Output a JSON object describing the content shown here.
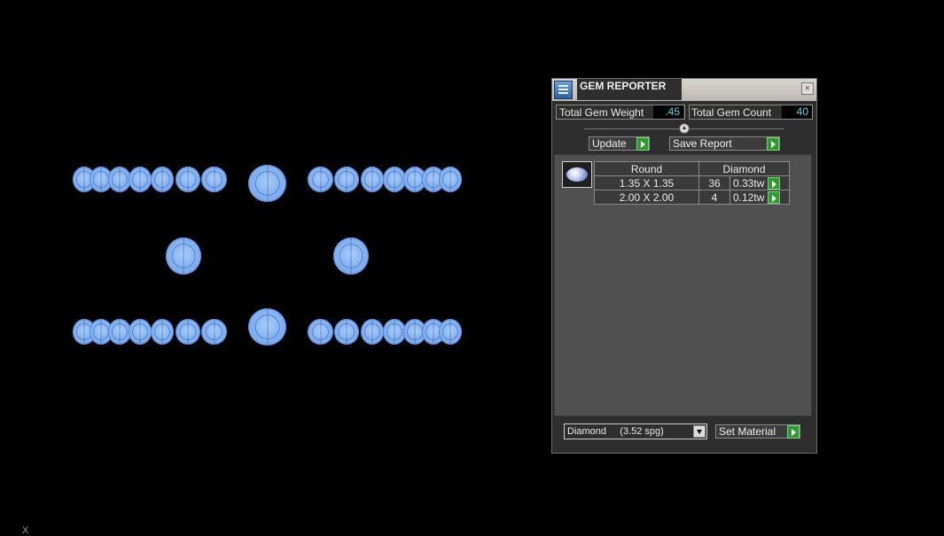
{
  "viewport": {
    "axis_label": "X"
  },
  "panel": {
    "title": "GEM REPORTER",
    "close_glyph": "×",
    "total_weight_label": "Total Gem Weight",
    "total_weight_value": ".45",
    "total_count_label": "Total Gem Count",
    "total_count_value": "40",
    "update_label": "Update",
    "save_report_label": "Save Report",
    "slider_glyph": "▲",
    "table": {
      "header_shape": "Round",
      "header_material": "Diamond",
      "rows": [
        {
          "size": "1.35 X 1.35",
          "count": "36",
          "weight": "0.33tw"
        },
        {
          "size": "2.00 X 2.00",
          "count": "4",
          "weight": "0.12tw"
        }
      ]
    },
    "material_value": "Diamond     (3.52 spg)",
    "set_material_label": "Set Material"
  },
  "icons": {
    "title": "gem-reporter-icon",
    "close": "close-icon",
    "play": "play-arrow-icon",
    "dropdown": "chevron-down-icon",
    "gem": "round-diamond-icon"
  },
  "colors": {
    "value_text": "#5fd6e8",
    "play_button": "#2f9a2f",
    "gem_blue": "#86b4f2"
  }
}
